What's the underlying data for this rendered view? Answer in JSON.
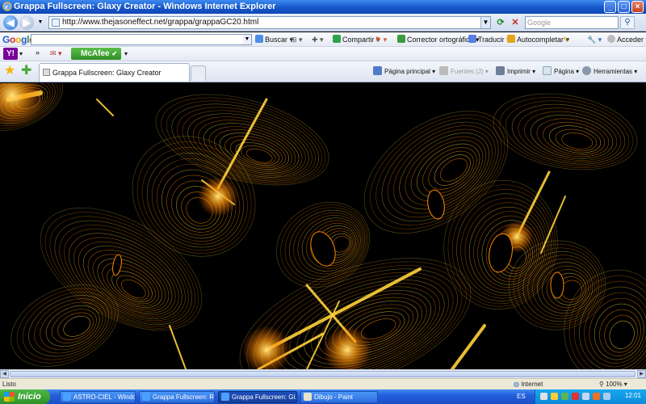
{
  "window": {
    "title": "Grappa Fullscreen: Glaxy Creator - Windows Internet Explorer",
    "minimize": "_",
    "maximize": "□",
    "close": "×"
  },
  "address": {
    "url": "http://www.thejasoneffect.net/grappa/grappaGC20.html",
    "search_placeholder": "Google"
  },
  "google_toolbar": {
    "logo": "Google",
    "items": [
      "Buscar",
      "Compartir",
      "Corrector ortográfico",
      "Traducir",
      "Autocompletar",
      "Acceder"
    ]
  },
  "yahoo_toolbar": {
    "logo": "Y!",
    "more": "»",
    "mcafee": "McAfee"
  },
  "tabs": {
    "active_tab": "Grappa Fullscreen: Glaxy Creator"
  },
  "command_bar": {
    "home": "Página principal",
    "feeds": "Fuentes (J)",
    "print": "Imprimir",
    "page": "Página",
    "tools": "Herramientas"
  },
  "status": {
    "text": "Listo",
    "zone": "Internet",
    "zoom": "100%"
  },
  "taskbar": {
    "start": "Inicio",
    "tasks": [
      {
        "label": "ASTRO-CIEL - Windo...",
        "active": false
      },
      {
        "label": "Grappa Fullscreen: R...",
        "active": false
      },
      {
        "label": "Grappa Fullscreen: Gl...",
        "active": true
      },
      {
        "label": "Dibujo - Paint",
        "active": false
      }
    ],
    "lang": "ES",
    "clock": "12:01"
  },
  "colors": {
    "title_blue": "#1657c9",
    "art_orange": "#ff8a00",
    "art_yellow": "#ffd23a",
    "taskbar_blue": "#245edb",
    "start_green": "#3aa636"
  }
}
